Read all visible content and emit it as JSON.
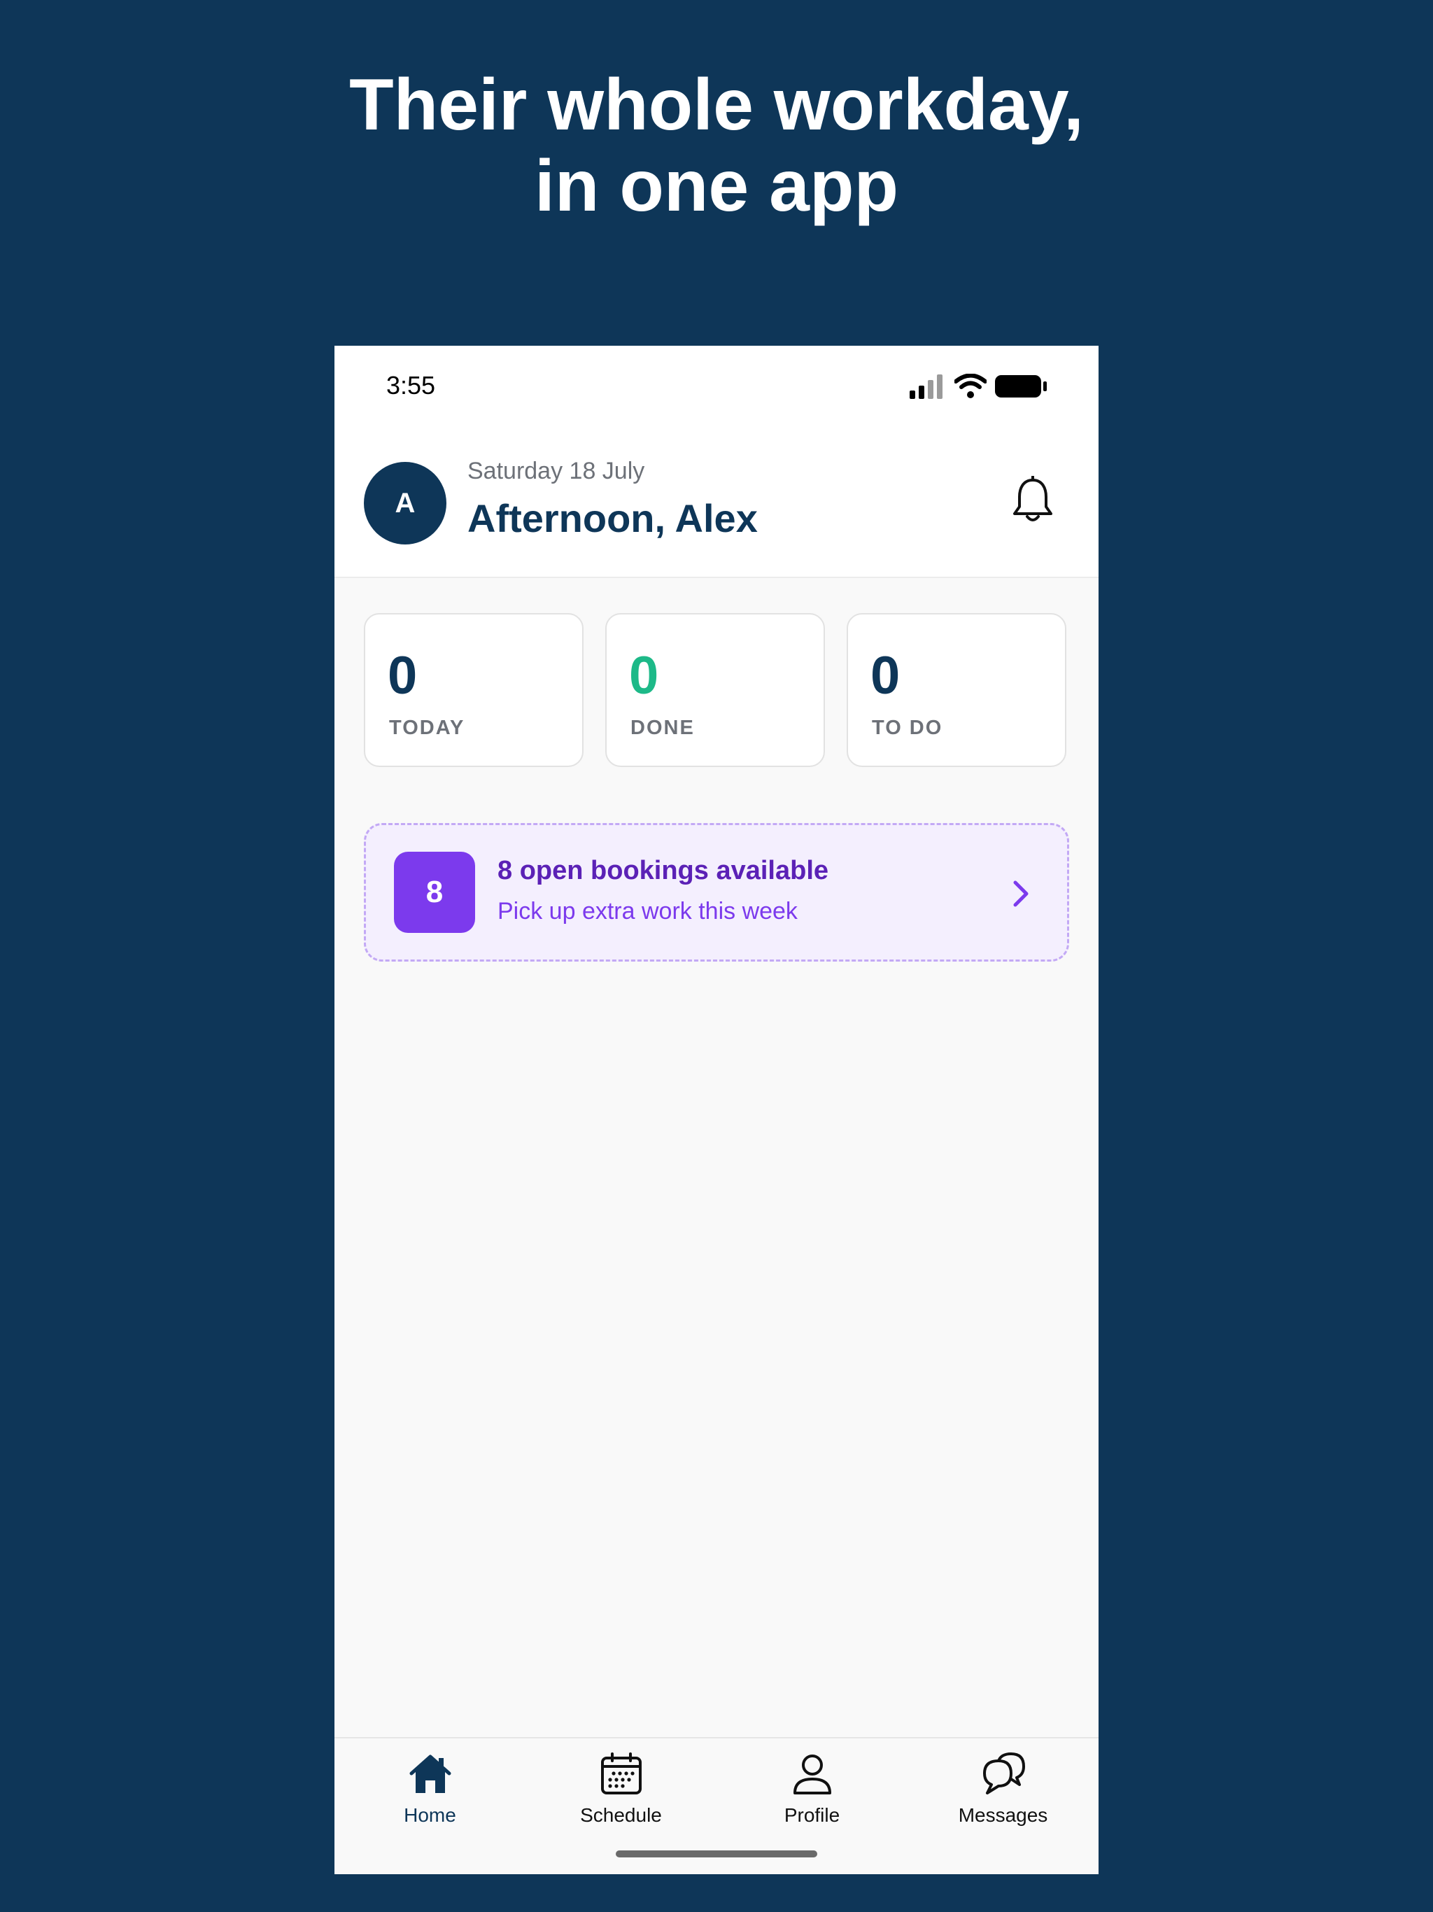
{
  "headline": {
    "line1": "Their whole workday,",
    "line2": "in one app"
  },
  "status_bar": {
    "time": "3:55"
  },
  "header": {
    "avatar_initial": "A",
    "date": "Saturday 18 July",
    "greeting": "Afternoon, Alex",
    "notification_icon": "bell-icon"
  },
  "stats": [
    {
      "value": "0",
      "label": "TODAY",
      "color": "#0e3658"
    },
    {
      "value": "0",
      "label": "DONE",
      "color": "#1db988"
    },
    {
      "value": "0",
      "label": "TO DO",
      "color": "#0e3658"
    }
  ],
  "bookings": {
    "count": "8",
    "title": "8 open bookings available",
    "subtitle": "Pick up extra work this week",
    "icon": "chevron-right-icon"
  },
  "tabs": [
    {
      "label": "Home",
      "icon": "home-icon",
      "active": true
    },
    {
      "label": "Schedule",
      "icon": "calendar-icon",
      "active": false
    },
    {
      "label": "Profile",
      "icon": "person-icon",
      "active": false
    },
    {
      "label": "Messages",
      "icon": "chat-bubbles-icon",
      "active": false
    }
  ],
  "colors": {
    "background": "#0e3658",
    "accent_purple": "#7c3aed",
    "done_green": "#1db988"
  }
}
